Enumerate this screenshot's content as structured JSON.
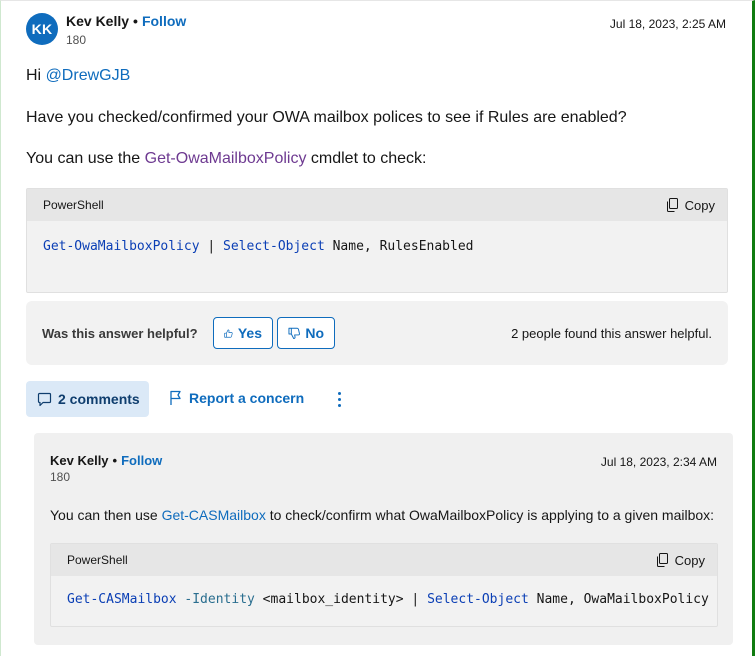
{
  "answer": {
    "author": {
      "initials": "KK",
      "name": "Kev Kelly",
      "separator": "•",
      "follow": "Follow",
      "reputation": "180"
    },
    "date": "Jul 18, 2023, 2:25 AM",
    "greeting_prefix": "Hi ",
    "mention": "@DrewGJB",
    "question": "Have you checked/confirmed your OWA mailbox polices to see if Rules are enabled?",
    "use_prefix": "You can use the ",
    "use_link": "Get-OwaMailboxPolicy",
    "use_suffix": " cmdlet to check:",
    "code": {
      "language": "PowerShell",
      "copy": "Copy",
      "tokens": {
        "cmd1": "Get-OwaMailboxPolicy",
        "pipe": " | ",
        "cmd2": "Select-Object",
        "args": " Name, RulesEnabled"
      }
    }
  },
  "helpful": {
    "question": "Was this answer helpful?",
    "yes": "Yes",
    "no": "No",
    "count_text": "2 people found this answer helpful."
  },
  "actions": {
    "comments": "2 comments",
    "report": "Report a concern",
    "more_icon": "more-vertical-icon"
  },
  "comment": {
    "author": {
      "name": "Kev Kelly",
      "separator": "•",
      "follow": "Follow",
      "reputation": "180"
    },
    "date": "Jul 18, 2023, 2:34 AM",
    "text_prefix": "You can then use ",
    "text_link": "Get-CASMailbox",
    "text_suffix": " to check/confirm what OwaMailboxPolicy is applying to a given mailbox:",
    "code": {
      "language": "PowerShell",
      "copy": "Copy",
      "tokens": {
        "cmd1": "Get-CASMailbox",
        "param": " -Identity",
        "arg": " <mailbox_identity>",
        "pipe": " | ",
        "cmd2": "Select-Object",
        "args": " Name, OwaMailboxPolicy"
      }
    }
  },
  "colors": {
    "accent": "#0f6cbd",
    "cmdlet_link": "#6e3a91",
    "frame_border": "#107c10"
  }
}
